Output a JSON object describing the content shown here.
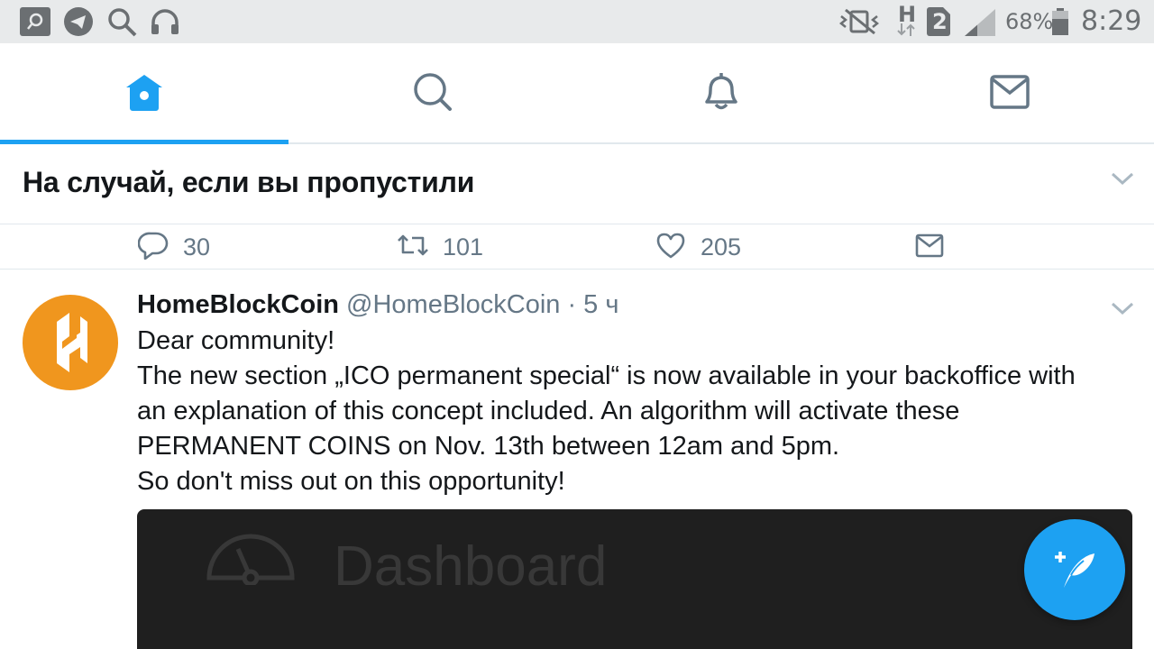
{
  "status_bar": {
    "battery": "68%",
    "time": "8:29",
    "network": "H",
    "sim": "2",
    "icons": [
      "search-app-icon",
      "telegram-icon",
      "search-icon",
      "headphones-icon",
      "vibrate-mute-icon",
      "network-h-icon",
      "sim-2-icon",
      "signal-icon",
      "battery-icon"
    ]
  },
  "tabs": [
    {
      "name": "home",
      "icon": "home-icon",
      "active": true
    },
    {
      "name": "search",
      "icon": "search-icon",
      "active": false
    },
    {
      "name": "notifications",
      "icon": "bell-icon",
      "active": false
    },
    {
      "name": "messages",
      "icon": "mail-icon",
      "active": false
    }
  ],
  "section": {
    "title": "На случай, если вы пропустили"
  },
  "actions": {
    "replies": "30",
    "retweets": "101",
    "likes": "205"
  },
  "tweet": {
    "name": "HomeBlockCoin",
    "handle": "@HomeBlockCoin",
    "time": " · 5 ч",
    "lines": [
      "Dear community!",
      "The new section „ICO permanent special“ is now available in your backoffice with",
      "an explanation of this concept included. An algorithm will activate these",
      "PERMANENT COINS on Nov. 13th between 12am and 5pm.",
      "So don't miss out on this opportunity!"
    ],
    "media_label": "Dashboard"
  },
  "colors": {
    "accent": "#1da1f2",
    "avatar": "#f0961e",
    "secondary_text": "#657786"
  }
}
